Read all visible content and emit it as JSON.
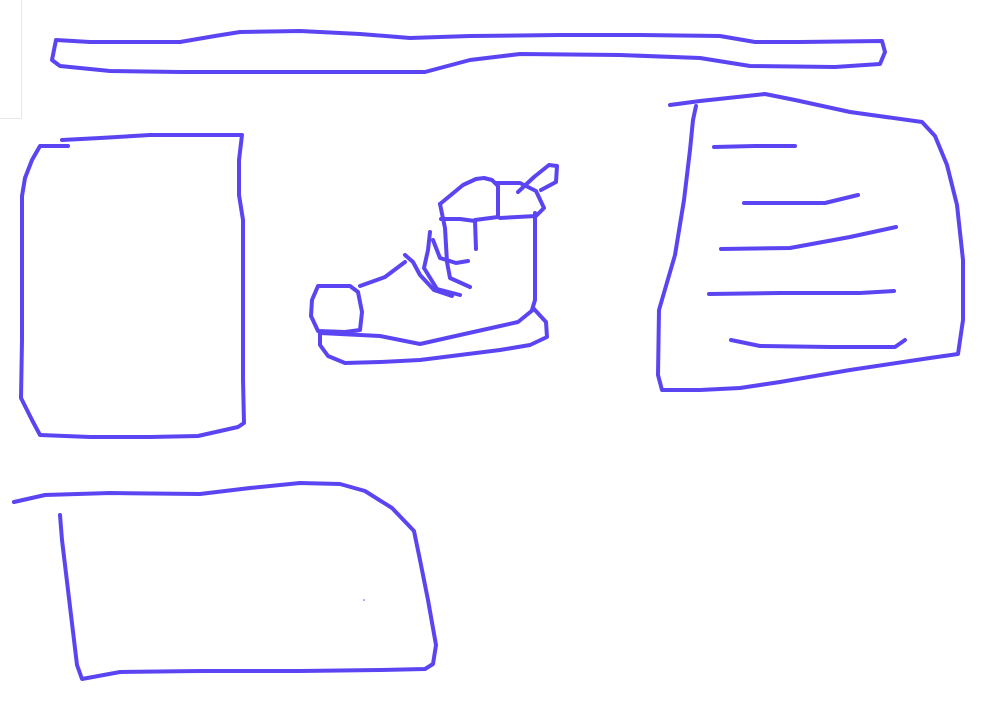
{
  "sketch": {
    "stroke_color": "#5b45f2",
    "background_color": "#ffffff",
    "elements": [
      {
        "name": "top-bar-sketch"
      },
      {
        "name": "left-panel-sketch"
      },
      {
        "name": "shoe-sketch"
      },
      {
        "name": "text-card-sketch",
        "text_lines": 5
      },
      {
        "name": "bottom-panel-sketch"
      }
    ]
  }
}
